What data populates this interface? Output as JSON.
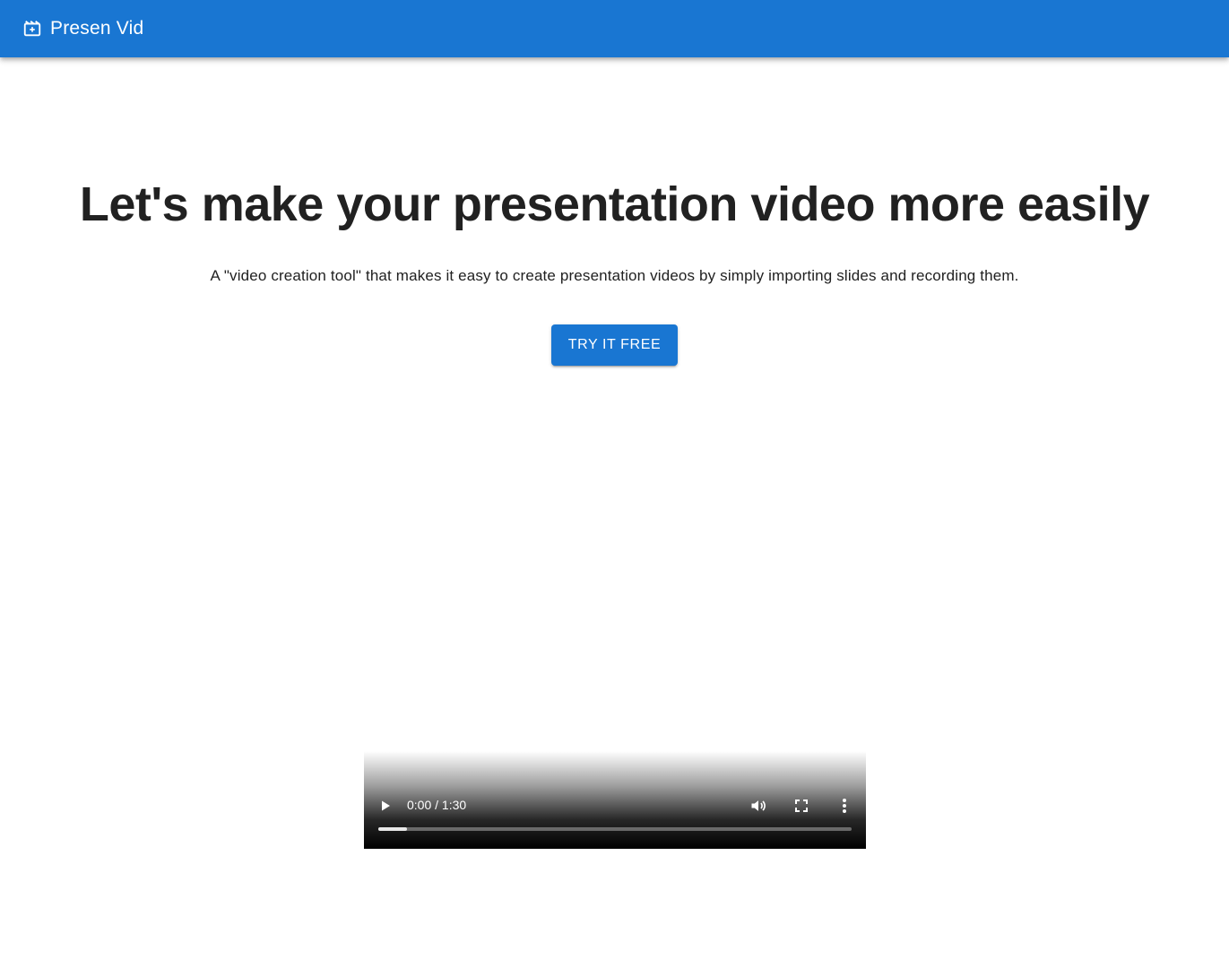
{
  "app_bar": {
    "title": "Presen Vid",
    "icon": "movie-icon",
    "color": "#1976d2"
  },
  "hero": {
    "title": "Let's make your presentation video more easily",
    "subtitle": "A \"video creation tool\" that makes it easy to create presentation videos by simply importing slides and recording them.",
    "cta_label": "TRY IT FREE"
  },
  "video": {
    "time_display": "0:00 / 1:30",
    "buffered_fraction": 0.06,
    "icons": {
      "play": "play-icon",
      "volume": "volume-icon",
      "fullscreen": "fullscreen-icon",
      "more": "more-vert-icon"
    }
  }
}
